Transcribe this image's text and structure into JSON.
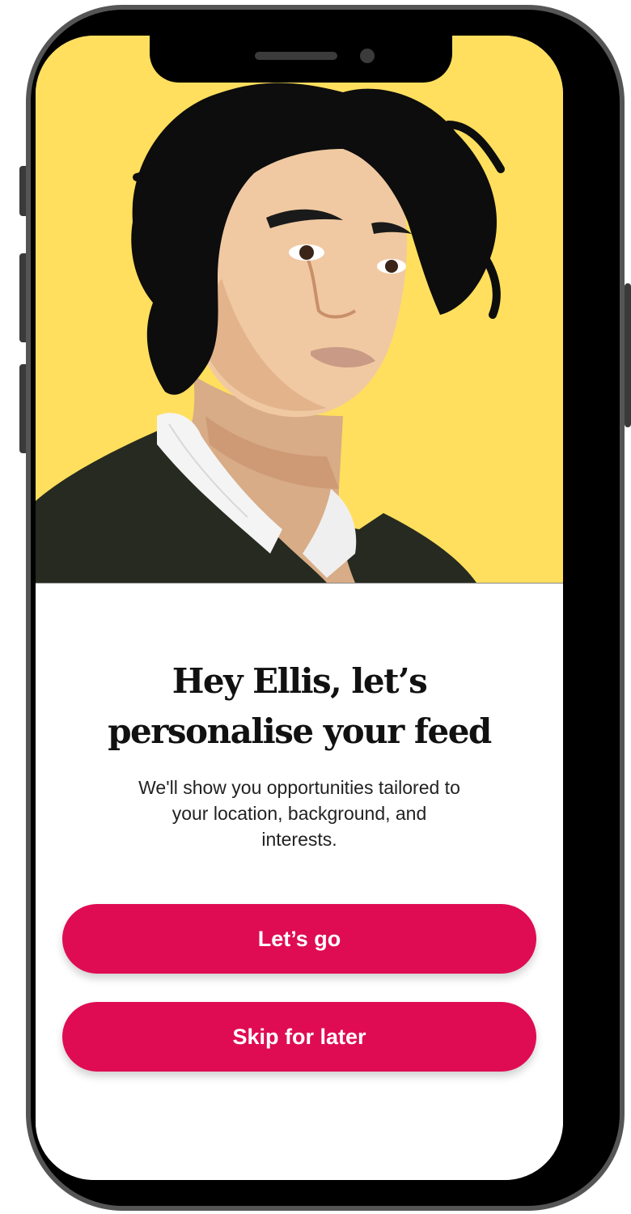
{
  "onboarding": {
    "heading_line1": "Hey Ellis, let’s",
    "heading_line2": "personalise your feed",
    "subtext": "We'll show you opportunities tailored to your location, background, and interests.",
    "primary_button": "Let’s go",
    "secondary_button": "Skip for later"
  },
  "colors": {
    "hero_background": "#ffdf5d",
    "button_accent": "#df0c53",
    "device_frame": "#000000"
  }
}
